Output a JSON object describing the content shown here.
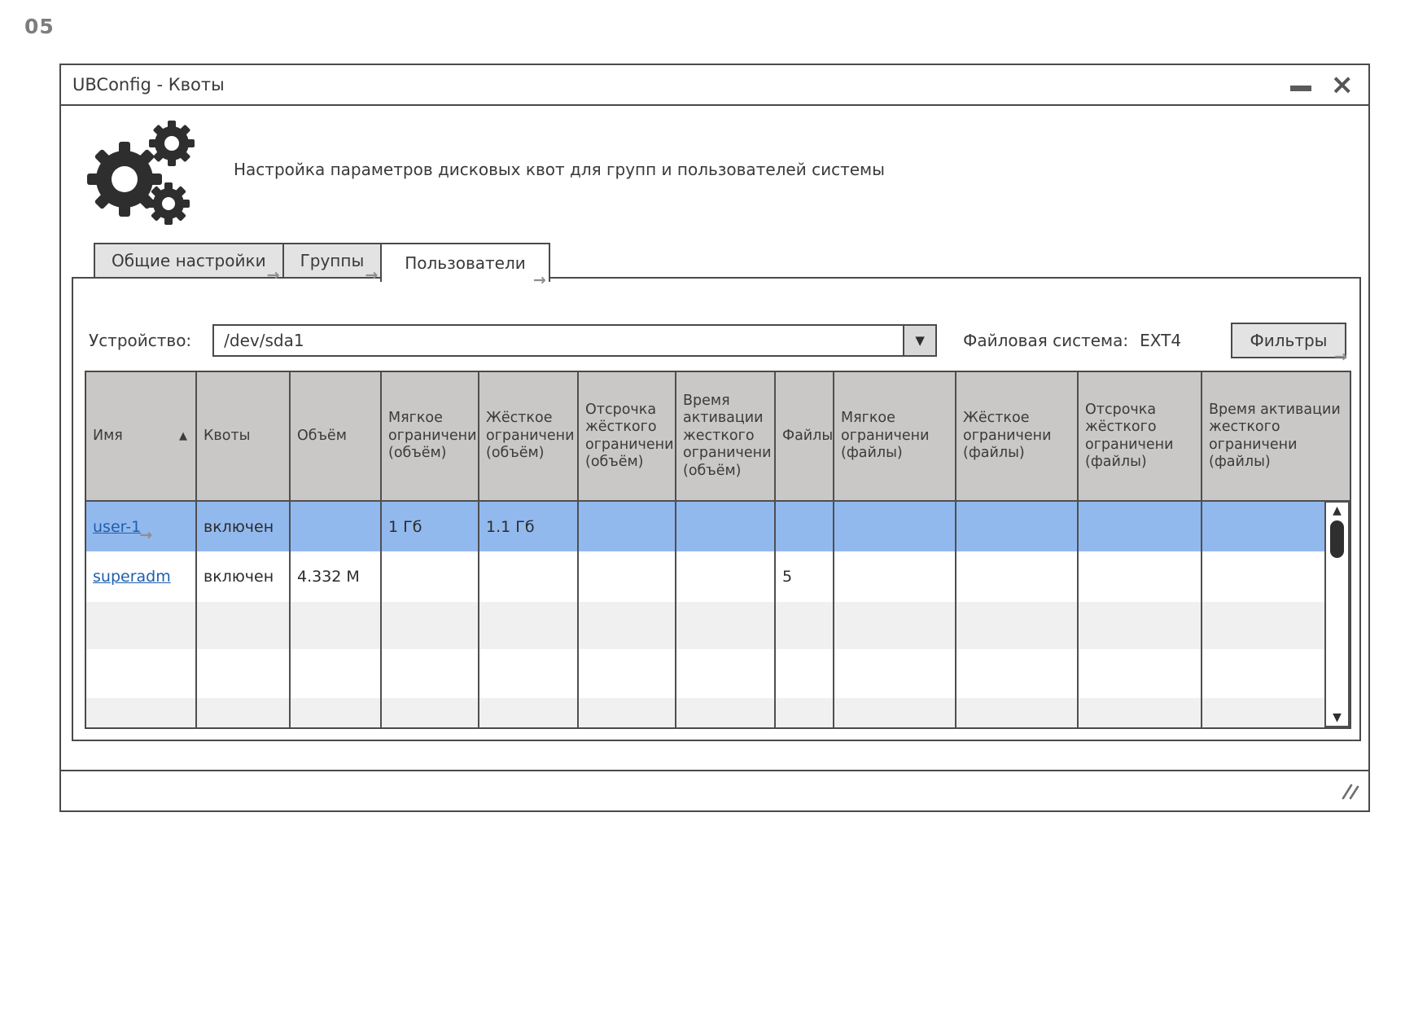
{
  "page": {
    "label": "05"
  },
  "window": {
    "title": "UBConfig - Квоты",
    "description": "Настройка параметров дисковых квот для групп и пользователей системы"
  },
  "tabs": [
    {
      "label": "Общие настройки",
      "active": false
    },
    {
      "label": "Группы",
      "active": false
    },
    {
      "label": "Пользователи",
      "active": true
    }
  ],
  "toolbar": {
    "device_label": "Устройство:",
    "device_value": "/dev/sda1",
    "filesystem_label": "Файловая система:",
    "filesystem_value": "EXT4",
    "filters_button": "Фильтры"
  },
  "icons": {
    "close": "×",
    "dropdown_arrow": "▼",
    "sort_asc": "▲",
    "link_arrow": "→",
    "scroll_up": "▲",
    "scroll_down": "▼"
  },
  "table": {
    "columns": [
      "Имя",
      "Квоты",
      "Объём",
      "Мягкое ограничени (объём)",
      "Жёсткое ограничени (объём)",
      "Отсрочка жёсткого ограничени (объём)",
      "Время активации жесткого ограничени (объём)",
      "Файлы",
      "Мягкое ограничени (файлы)",
      "Жёсткое ограничени (файлы)",
      "Отсрочка жёсткого ограничени (файлы)",
      "Время активации жесткого ограничени (файлы)"
    ],
    "sorted_column": "Имя",
    "rows": [
      {
        "selected": true,
        "cells": [
          "user-1",
          "включен",
          "",
          "1 Гб",
          "1.1 Гб",
          "",
          "",
          "",
          "",
          "",
          "",
          ""
        ]
      },
      {
        "selected": false,
        "cells": [
          "superadm",
          "включен",
          "4.332 M",
          "",
          "",
          "",
          "",
          "5",
          "",
          "",
          "",
          ""
        ]
      }
    ],
    "empty_row_count": 3
  },
  "colors": {
    "selected_row": "#92b9ee",
    "header_bg": "#c9c8c6",
    "link": "#1f5fae",
    "border": "#4a4a4a",
    "stripe": "#f0f0f0"
  }
}
